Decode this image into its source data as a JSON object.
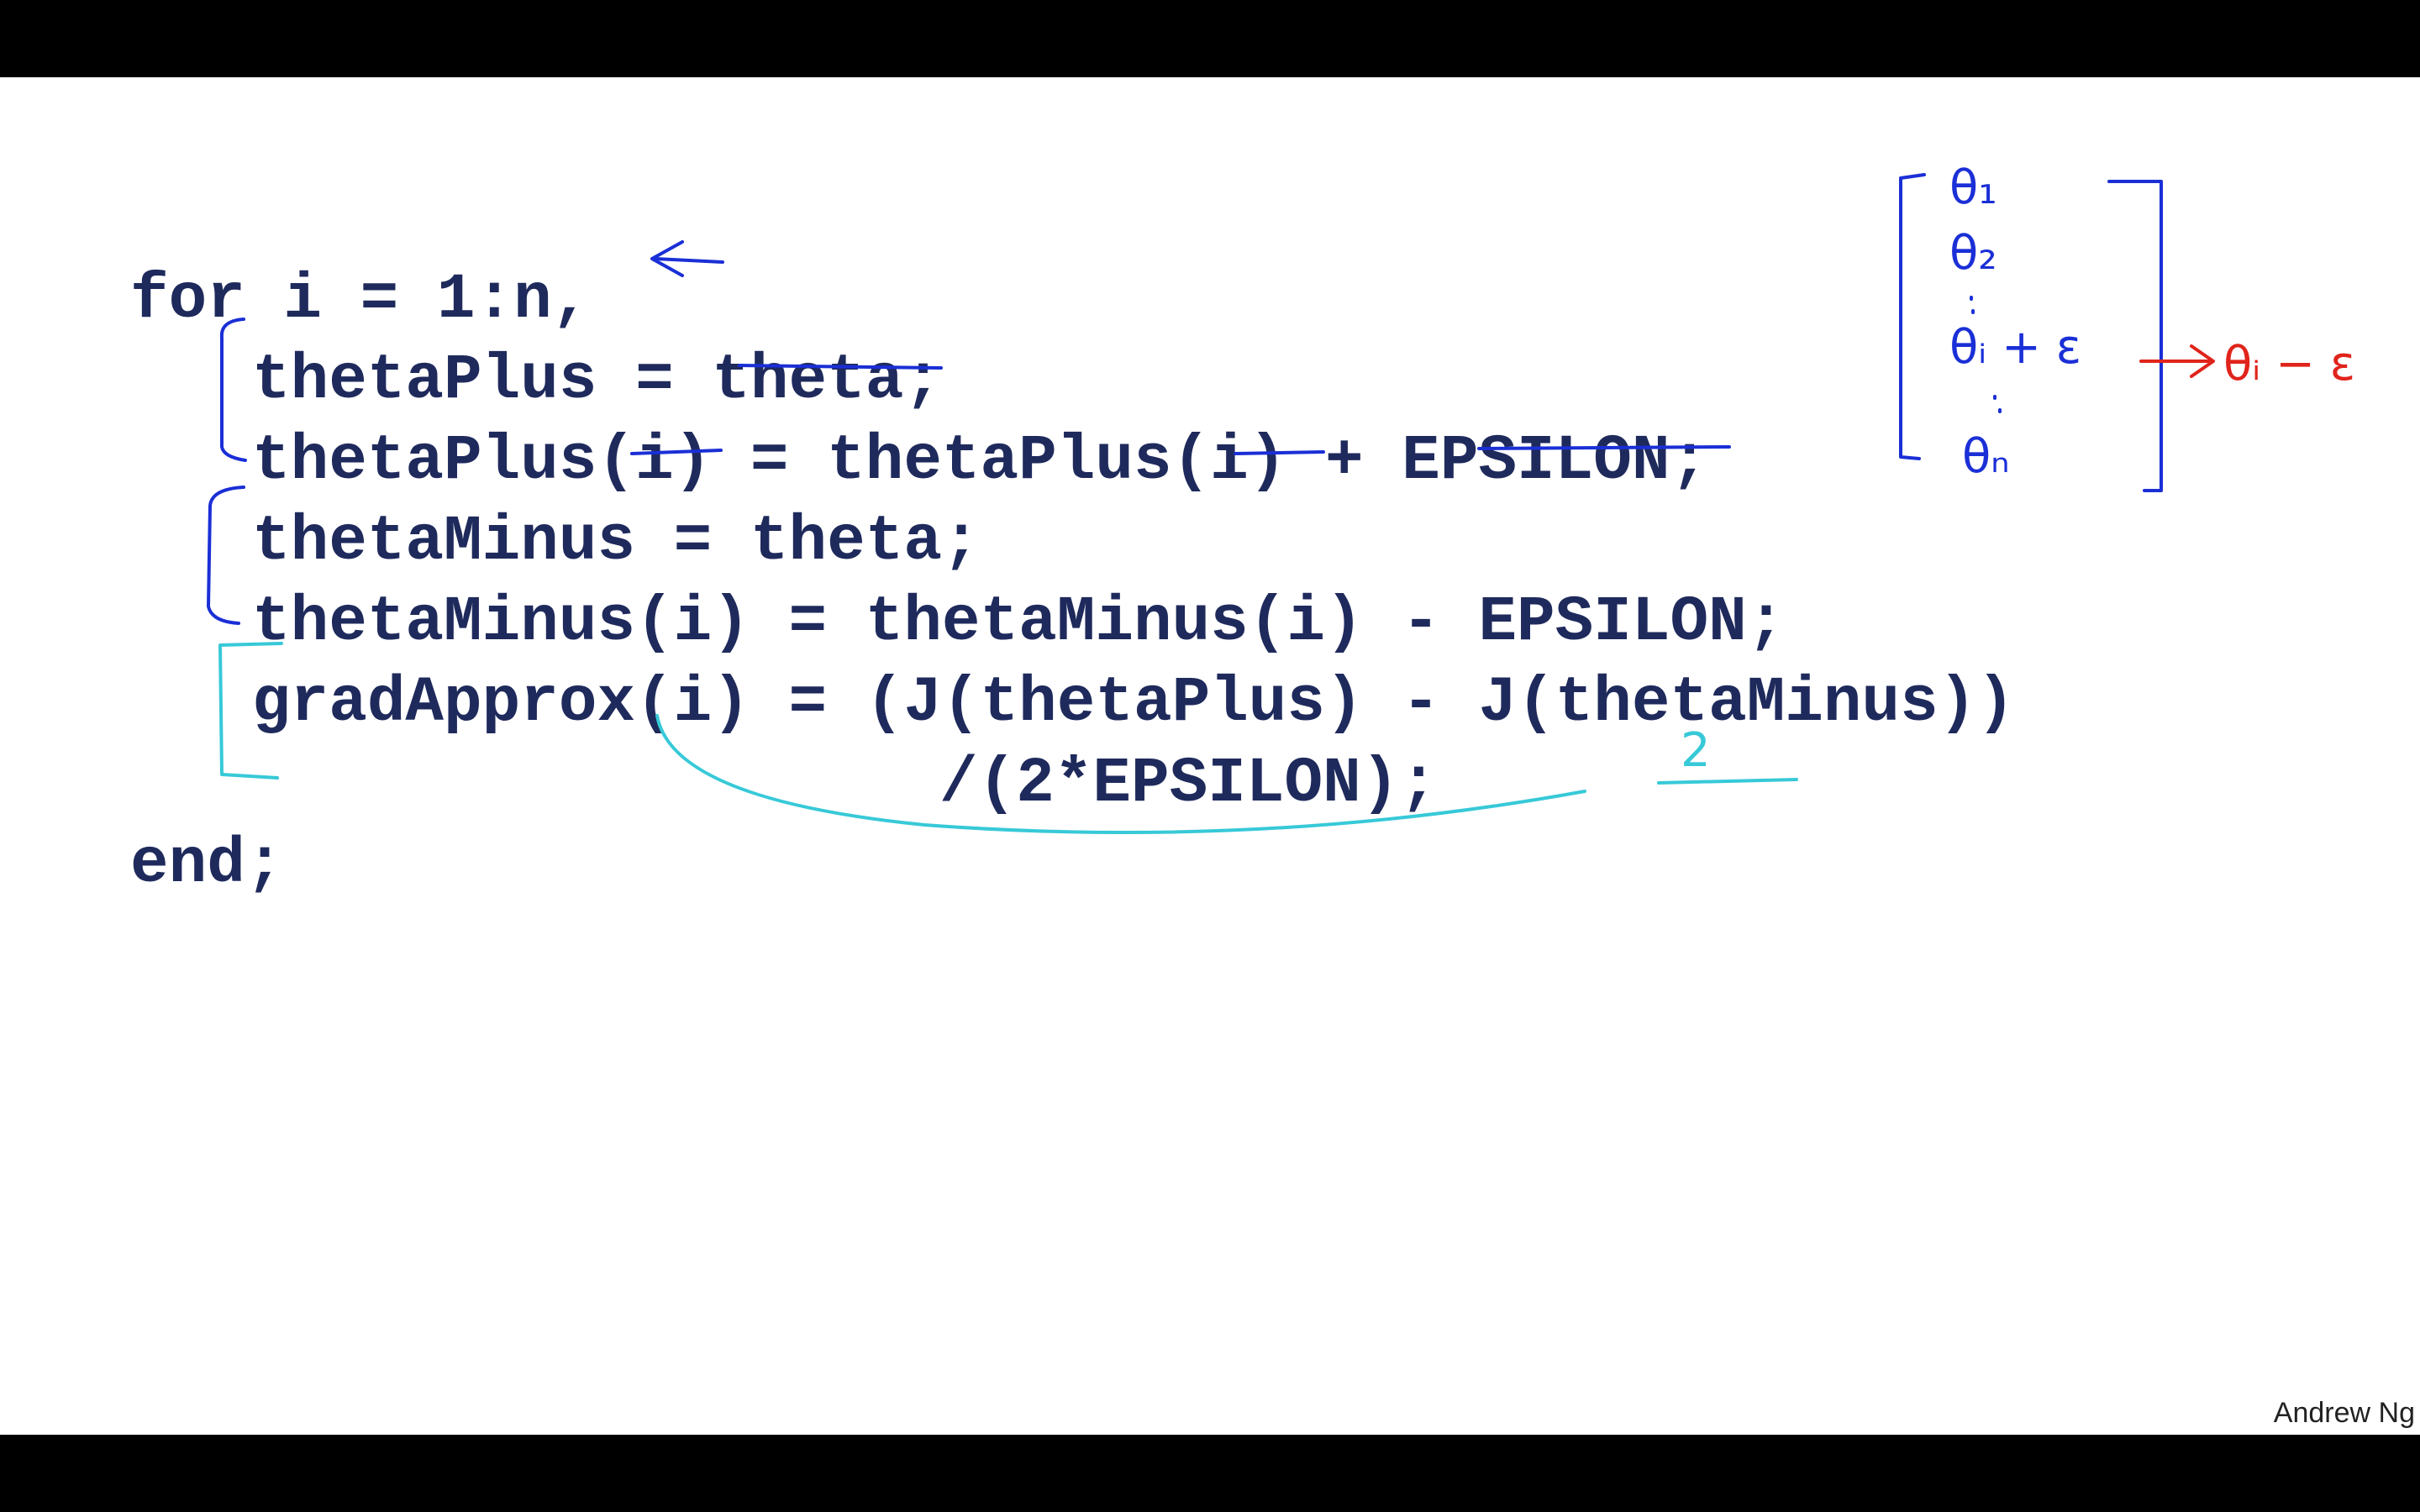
{
  "code": {
    "line1": "for i = 1:n,",
    "line2": "thetaPlus = theta;",
    "line3": "thetaPlus(i) = thetaPlus(i) + EPSILON;",
    "line4": "thetaMinus = theta;",
    "line5": "thetaMinus(i) = thetaMinus(i) - EPSILON;",
    "line6": "gradApprox(i) = (J(thetaPlus) - J(thetaMinus))",
    "line7": "/(2*EPSILON);",
    "line8": "end;"
  },
  "credit": "Andrew Ng",
  "annotations": {
    "vector": [
      "θ₁",
      "θ₂",
      "θᵢ + ε",
      "θₙ"
    ],
    "perturb_minus": "θᵢ − ε",
    "denominator_note": "2"
  },
  "colors": {
    "code_text": "#1f2a5c",
    "ink_blue": "#1a2fd6",
    "ink_red": "#e0241b",
    "ink_cyan": "#37c9d8",
    "letterbox": "#000000",
    "slide_background": "#ffffff"
  }
}
